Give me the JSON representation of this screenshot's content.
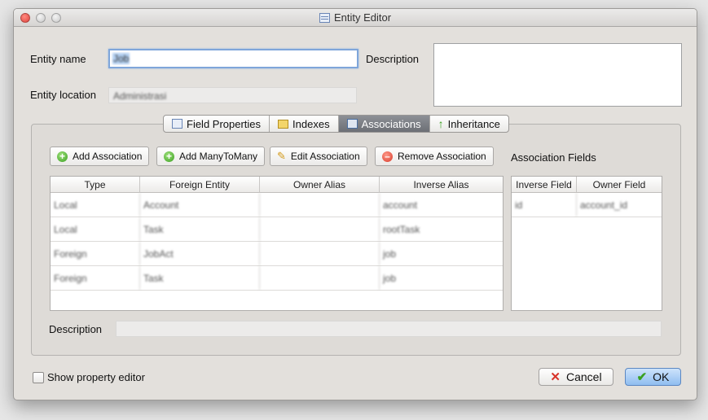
{
  "window": {
    "title": "Entity Editor"
  },
  "form": {
    "entity_name_label": "Entity name",
    "entity_name_value": "Job",
    "description_label": "Description",
    "entity_location_label": "Entity location",
    "entity_location_value": "Administrasi"
  },
  "tabs": [
    {
      "label": "Field Properties",
      "icon": "table-icon"
    },
    {
      "label": "Indexes",
      "icon": "index-icon"
    },
    {
      "label": "Associations",
      "icon": "association-icon",
      "active": true
    },
    {
      "label": "Inheritance",
      "icon": "up-arrow-icon"
    }
  ],
  "actions": {
    "add_association": "Add Association",
    "add_many_to_many": "Add ManyToMany",
    "edit_association": "Edit Association",
    "remove_association": "Remove Association"
  },
  "associations_table": {
    "columns": [
      "Type",
      "Foreign Entity",
      "Owner Alias",
      "Inverse Alias"
    ],
    "rows": [
      [
        "Local",
        "Account",
        "",
        "account"
      ],
      [
        "Local",
        "Task",
        "",
        "rootTask"
      ],
      [
        "Foreign",
        "JobAct",
        "",
        "job"
      ],
      [
        "Foreign",
        "Task",
        "",
        "job"
      ]
    ]
  },
  "association_fields": {
    "title": "Association Fields",
    "columns": [
      "Inverse Field",
      "Owner Field"
    ],
    "rows": [
      [
        "id",
        "account_id"
      ]
    ]
  },
  "description_label": "Description",
  "footer": {
    "show_property_editor": "Show property editor",
    "cancel": "Cancel",
    "ok": "OK"
  },
  "colors": {
    "ok_button": "#8fbdf0",
    "active_tab": "#7d8086",
    "focus_ring": "#7fa6da"
  }
}
